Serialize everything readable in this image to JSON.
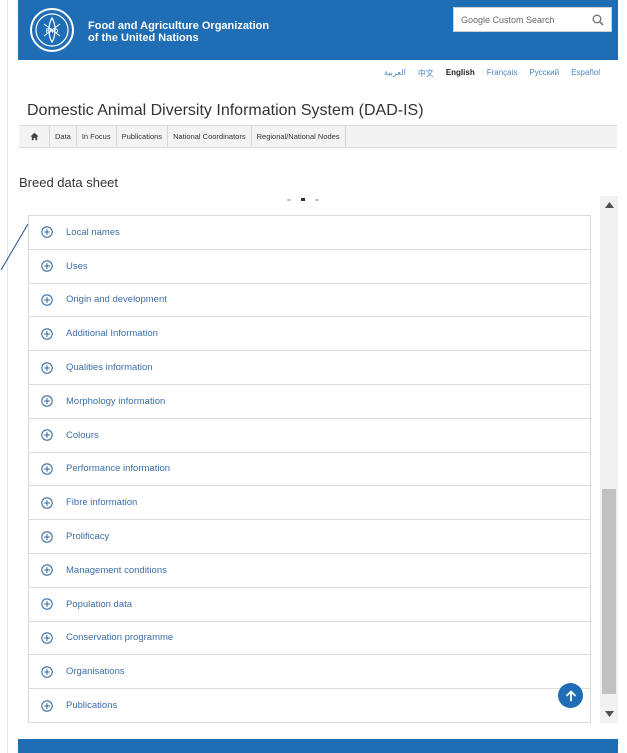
{
  "header": {
    "org_line1": "Food and Agriculture Organization",
    "org_line2": "of the United Nations",
    "search_placeholder": "Google Custom Search",
    "brand_color": "#1e6db5"
  },
  "languages": [
    {
      "label": "العربية",
      "active": false
    },
    {
      "label": "中文",
      "active": false
    },
    {
      "label": "English",
      "active": true
    },
    {
      "label": "Français",
      "active": false
    },
    {
      "label": "Русский",
      "active": false
    },
    {
      "label": "Español",
      "active": false
    }
  ],
  "site_title": "Domestic Animal Diversity Information System (DAD-IS)",
  "nav": {
    "home_icon": "home-icon",
    "items": [
      "Data",
      "In Focus",
      "Publications",
      "National Coordinators",
      "Regional/National Nodes"
    ]
  },
  "sheet_title": "Breed data sheet",
  "accordion": {
    "icon": "circle-plus-icon",
    "items": [
      "Local names",
      "Uses",
      "Origin and development",
      "Additional Information",
      "Qualities information",
      "Morphology information",
      "Colours",
      "Performance information",
      "Fibre information",
      "Prolificacy",
      "Management conditions",
      "Population data",
      "Conservation programme",
      "Organisations",
      "Publications"
    ]
  }
}
